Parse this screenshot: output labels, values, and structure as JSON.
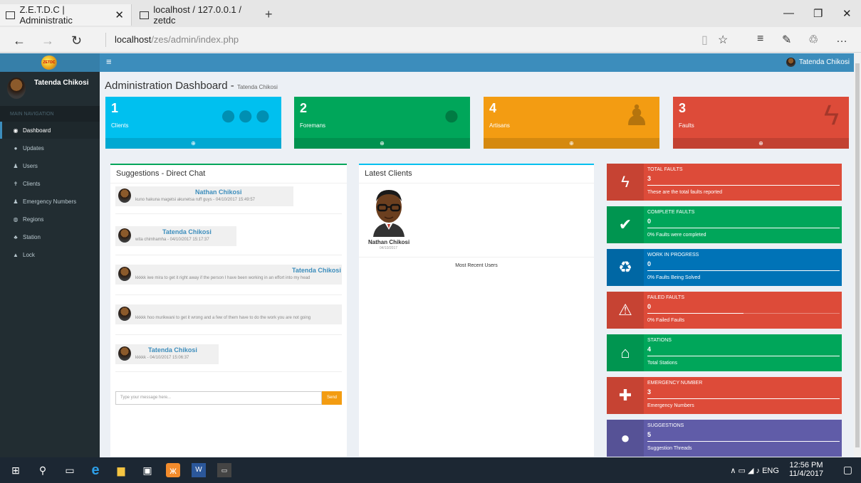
{
  "browser": {
    "tabs": [
      {
        "title": "Z.E.T.D.C | Administratic"
      },
      {
        "title": "localhost / 127.0.0.1 / zetdc"
      }
    ],
    "url_host": "localhost",
    "url_path": "/zes/admin/index.php"
  },
  "header": {
    "logo_text": "ZETDC",
    "user_name": "Tatenda Chikosi"
  },
  "sidebar": {
    "user_name": "Tatenda Chikosi",
    "section_label": "MAIN NAVIGATION",
    "items": [
      {
        "label": "Dashboard",
        "icon": "dashboard-icon"
      },
      {
        "label": "Updates",
        "icon": "comment-icon"
      },
      {
        "label": "Users",
        "icon": "user-icon"
      },
      {
        "label": "Clients",
        "icon": "male-icon"
      },
      {
        "label": "Emergency Numbers",
        "icon": "users-icon"
      },
      {
        "label": "Regions",
        "icon": "globe-icon"
      },
      {
        "label": "Station",
        "icon": "sitemap-icon"
      },
      {
        "label": "Lock",
        "icon": "lock-icon"
      }
    ]
  },
  "page": {
    "title": "Administration Dashboard",
    "subtitle": "Tatenda Chikosi"
  },
  "stat_boxes": [
    {
      "value": "1",
      "label": "Clients",
      "color": "#00c0ef",
      "icon": "users-icon"
    },
    {
      "value": "2",
      "label": "Foremans",
      "color": "#00a65a",
      "icon": "user-icon"
    },
    {
      "value": "4",
      "label": "Artisans",
      "color": "#f39c12",
      "icon": "male-icon"
    },
    {
      "value": "3",
      "label": "Faults",
      "color": "#dd4b39",
      "icon": "bolt-icon"
    }
  ],
  "chat": {
    "title": "Suggestions - Direct Chat",
    "messages": [
      {
        "name": "Nathan Chikosi",
        "text": "kuno hakuna magetsi akunetsa ruff guys - 04/10/2017 15:49:57"
      },
      {
        "name": "Tatenda Chikosi",
        "text": "wita chimhamha - 04/10/2017 15:17:37"
      },
      {
        "name": "Tatenda Chikosi",
        "text": "kkkkk iwe mira to get it right away if the person I have been working in an effort into my head"
      },
      {
        "name": "",
        "text": "kkkkk hoo murikwani to get it wrong and a few of them have to do the work you are not going"
      },
      {
        "name": "Tatenda Chikosi",
        "text": "kkkkk - 04/10/2017 15:06:37"
      }
    ],
    "input_placeholder": "Type your message here...",
    "send_label": "Send"
  },
  "clients": {
    "title": "Latest Clients",
    "client_name": "Nathan Chikosi",
    "client_date": "04/10/2017",
    "footer": "Most Recent Users"
  },
  "info_boxes": [
    {
      "title": "TOTAL FAULTS",
      "value": "3",
      "desc": "These are the total faults reported",
      "color": "#dd4b39",
      "icon": "bolt-icon",
      "progress": 1.0
    },
    {
      "title": "COMPLETE FAULTS",
      "value": "0",
      "desc": "0% Faults were completed",
      "color": "#00a65a",
      "icon": "check-icon",
      "progress": 1.0
    },
    {
      "title": "WORK IN PROGRESS",
      "value": "0",
      "desc": "0% Faults Being Solved",
      "color": "#0073b7",
      "icon": "recycle-icon",
      "progress": 1.0
    },
    {
      "title": "FAILED FAULTS",
      "value": "0",
      "desc": "0% Failed Faults",
      "color": "#dd4b39",
      "icon": "warning-icon",
      "progress": 0.5
    },
    {
      "title": "STATIONS",
      "value": "4",
      "desc": "Total Stations",
      "color": "#00a65a",
      "icon": "bank-icon",
      "progress": 1.0
    },
    {
      "title": "EMERGENCY NUMBER",
      "value": "3",
      "desc": "Emergency Numbers",
      "color": "#dd4b39",
      "icon": "ambulance-icon",
      "progress": 1.0
    },
    {
      "title": "SUGGESTIONS",
      "value": "5",
      "desc": "Suggestion Threads",
      "color": "#605ca8",
      "icon": "comments-icon",
      "progress": 1.0
    }
  ],
  "taskbar": {
    "language": "ENG",
    "time": "12:56 PM",
    "date": "11/4/2017"
  }
}
